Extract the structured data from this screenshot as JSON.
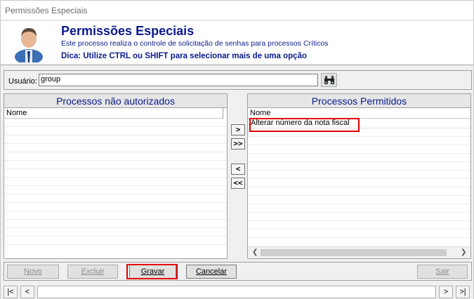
{
  "window": {
    "title": "Permissões Especiais"
  },
  "header": {
    "title": "Permissões Especiais",
    "subtitle": "Este processo realiza o controle de solicitação de senhas para processos Críticos",
    "tip": "Dica: Utilize CTRL ou SHIFT para selecionar mais de uma opção",
    "avatar_icon": "user-avatar-icon"
  },
  "user": {
    "label": "Usuário:",
    "value": "group",
    "search_icon": "binoculars-icon"
  },
  "left_panel": {
    "title": "Processos não autorizados",
    "column": "Nome",
    "items": []
  },
  "right_panel": {
    "title": "Processos Permitidos",
    "column": "Nome",
    "items": [
      "Alterar número da nota fiscal"
    ]
  },
  "move_buttons": {
    "add": ">",
    "add_all": ">>",
    "remove": "<",
    "remove_all": "<<"
  },
  "toolbar": {
    "new": "Novo",
    "delete": "Excluir",
    "save": "Gravar",
    "cancel": "Cancelar",
    "exit": "Sair"
  },
  "nav": {
    "first": "|<",
    "prev": "<",
    "next": ">",
    "last": ">|"
  },
  "colors": {
    "title_blue": "#0a1a8c",
    "highlight_red": "#e00000"
  }
}
